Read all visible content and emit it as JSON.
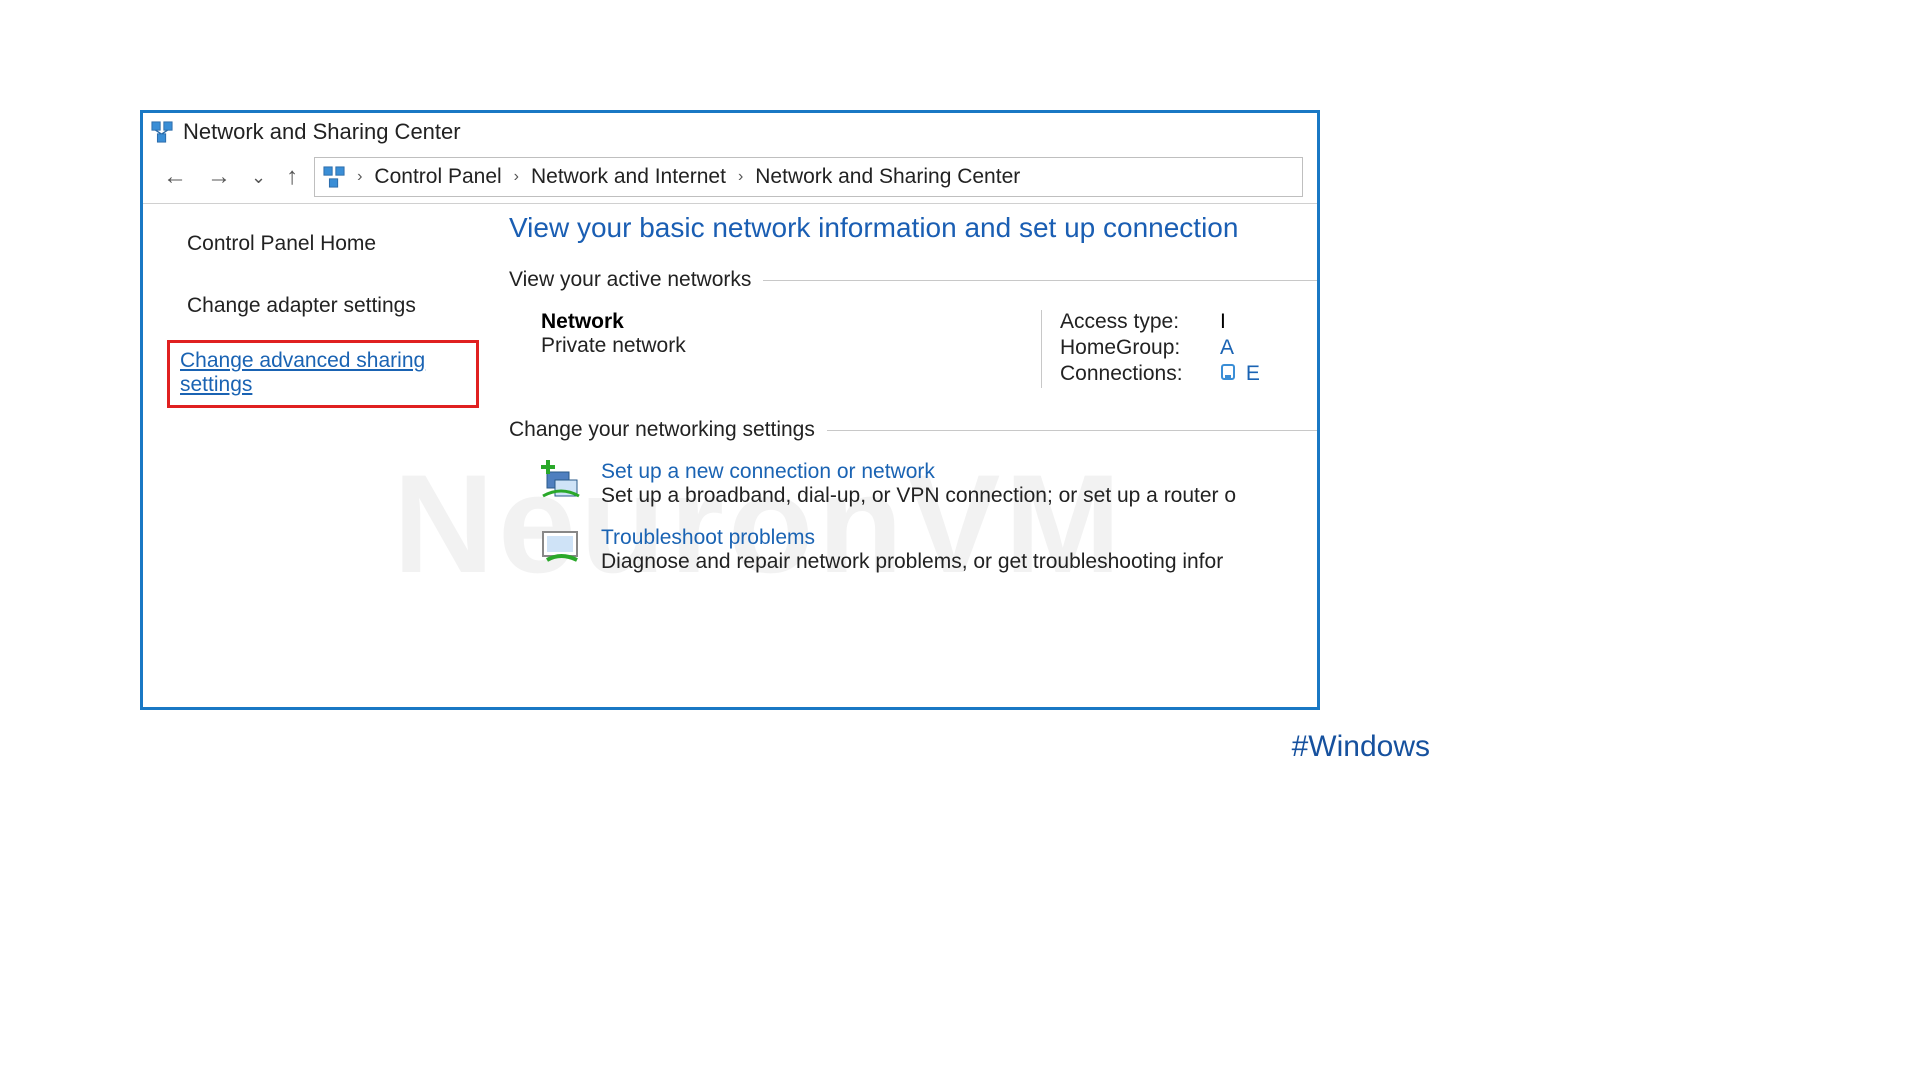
{
  "window": {
    "title": "Network and Sharing Center"
  },
  "breadcrumb": {
    "items": [
      "Control Panel",
      "Network and Internet",
      "Network and Sharing Center"
    ]
  },
  "sidebar": {
    "home": "Control Panel Home",
    "adapter": "Change adapter settings",
    "advanced": "Change advanced sharing settings"
  },
  "main": {
    "heading": "View your basic network information and set up connection",
    "active_section": "View your active networks",
    "network": {
      "name": "Network",
      "type": "Private network",
      "access_label": "Access type:",
      "access_value": "I",
      "homegroup_label": "HomeGroup:",
      "homegroup_value": "A",
      "connections_label": "Connections:",
      "connections_value": "E"
    },
    "change_section": "Change your networking settings",
    "actions": {
      "setup": {
        "title": "Set up a new connection or network",
        "desc": "Set up a broadband, dial-up, or VPN connection; or set up a router o"
      },
      "troubleshoot": {
        "title": "Troubleshoot problems",
        "desc": "Diagnose and repair network problems, or get troubleshooting infor"
      }
    }
  },
  "watermark": "NeuronVM",
  "hashtag": "#Windows"
}
